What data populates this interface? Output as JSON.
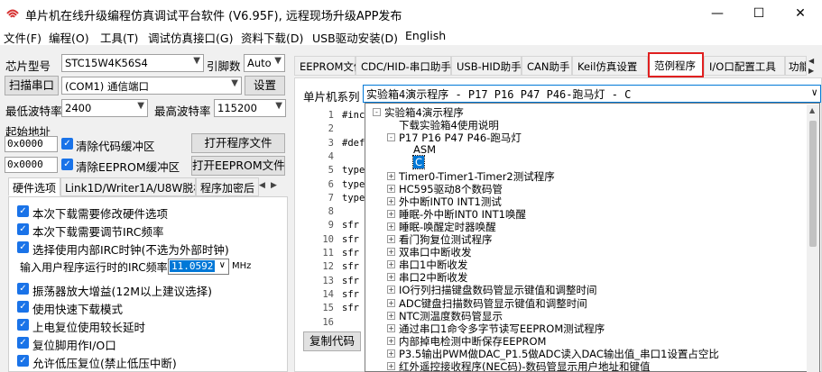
{
  "window": {
    "title": "单片机在线升级编程仿真调试平台软件 (V6.95F), 远程现场升级APP发布",
    "minimize": "—",
    "maximize": "☐",
    "close": "✕"
  },
  "menu": [
    "文件(F)",
    "编程(O)",
    "工具(T)",
    "调试仿真接口(G)",
    "资料下载(D)",
    "USB驱动安装(D)",
    "English"
  ],
  "left": {
    "chip_label": "芯片型号",
    "chip_value": "STC15W4K56S4",
    "pin_label": "引脚数",
    "pin_value": "Auto",
    "scan_button": "扫描串口",
    "port_value": "(COM1) 通信端口",
    "settings_button": "设置",
    "min_baud_label": "最低波特率",
    "min_baud_value": "2400",
    "max_baud_label": "最高波特率",
    "max_baud_value": "115200",
    "start_addr_label": "起始地址",
    "addr1": "0x0000",
    "clear_code": "清除代码缓冲区",
    "open_program": "打开程序文件",
    "addr2": "0x0000",
    "clear_eeprom": "清除EEPROM缓冲区",
    "open_eeprom": "打开EEPROM文件",
    "tabs": [
      "硬件选项",
      "Link1D/Writer1A/U8W脱机",
      "程序加密后"
    ],
    "options": [
      "本次下载需要修改硬件选项",
      "本次下载需要调节IRC频率",
      "选择使用内部IRC时钟(不选为外部时钟)"
    ],
    "irc_label": "输入用户程序运行时的IRC频率",
    "irc_value": "11.0592",
    "irc_unit": "MHz",
    "options2": [
      "振荡器放大增益(12M以上建议选择)",
      "使用快速下载模式",
      "上电复位使用较长延时",
      "复位脚用作I/O口",
      "允许低压复位(禁止低压中断)"
    ]
  },
  "right": {
    "tabs": [
      "EEPROM文件",
      "CDC/HID-串口助手",
      "USB-HID助手",
      "CAN助手",
      "Keil仿真设置",
      "范例程序",
      "I/O口配置工具",
      "功能"
    ],
    "series_label": "单片机系列",
    "series_value": "实验箱4演示程序 - P17 P16 P47 P46-跑马灯 - C",
    "line_numbers": [
      "1",
      "2",
      "3",
      "4",
      "5",
      "6",
      "7",
      "8",
      "9",
      "10",
      "11",
      "12",
      "13",
      "14",
      "15",
      "16"
    ],
    "code_lines": [
      "#inc",
      "",
      "#def",
      "",
      "type",
      "type",
      "type",
      "",
      "sfr",
      "sfr",
      "sfr",
      "sfr",
      "sfr",
      "sfr",
      "sfr",
      ""
    ],
    "copy_button": "复制代码",
    "tree": [
      {
        "level": 0,
        "box": "-",
        "text": "实验箱4演示程序"
      },
      {
        "level": 1,
        "box": "",
        "text": "下载实验箱4使用说明"
      },
      {
        "level": 1,
        "box": "-",
        "text": "P17 P16 P47 P46-跑马灯"
      },
      {
        "level": 2,
        "box": "",
        "text": "ASM"
      },
      {
        "level": 2,
        "box": "",
        "text": "C",
        "selected": true
      },
      {
        "level": 1,
        "box": "+",
        "text": "Timer0-Timer1-Timer2测试程序"
      },
      {
        "level": 1,
        "box": "+",
        "text": "HC595驱动8个数码管"
      },
      {
        "level": 1,
        "box": "+",
        "text": "外中断INT0 INT1测试"
      },
      {
        "level": 1,
        "box": "+",
        "text": "睡眠-外中断INT0 INT1唤醒"
      },
      {
        "level": 1,
        "box": "+",
        "text": "睡眠-唤醒定时器唤醒"
      },
      {
        "level": 1,
        "box": "+",
        "text": "看门狗复位测试程序"
      },
      {
        "level": 1,
        "box": "+",
        "text": "双串口中断收发"
      },
      {
        "level": 1,
        "box": "+",
        "text": "串口1中断收发"
      },
      {
        "level": 1,
        "box": "+",
        "text": "串口2中断收发"
      },
      {
        "level": 1,
        "box": "+",
        "text": "IO行列扫描键盘数码管显示键值和调整时间"
      },
      {
        "level": 1,
        "box": "+",
        "text": "ADC键盘扫描数码管显示键值和调整时间"
      },
      {
        "level": 1,
        "box": "+",
        "text": "NTC测温度数码管显示"
      },
      {
        "level": 1,
        "box": "+",
        "text": "通过串口1命令多字节读写EEPROM测试程序"
      },
      {
        "level": 1,
        "box": "+",
        "text": "内部掉电检测中断保存EEPROM"
      },
      {
        "level": 1,
        "box": "+",
        "text": "P3.5输出PWM做DAC_P1.5做ADC读入DAC输出值_串口1设置占空比"
      },
      {
        "level": 1,
        "box": "+",
        "text": "红外遥控接收程序(NEC码)-数码管显示用户地址和键值"
      }
    ]
  },
  "colors": {
    "accent": "#1a73e8",
    "highlight": "#e02020",
    "selected": "#0078d7"
  }
}
